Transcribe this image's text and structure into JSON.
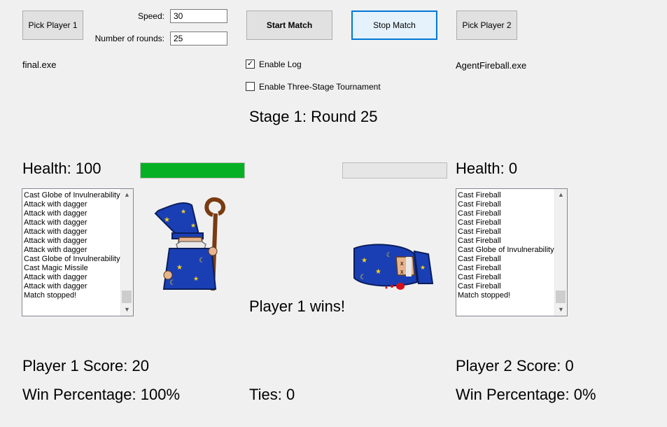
{
  "buttons": {
    "pick_player1": "Pick Player 1",
    "start_match": "Start Match",
    "stop_match": "Stop Match",
    "pick_player2": "Pick Player 2"
  },
  "settings": {
    "speed_label": "Speed:",
    "speed_value": "30",
    "rounds_label": "Number of rounds:",
    "rounds_value": "25",
    "enable_log_label": "Enable Log",
    "enable_log_checked": true,
    "three_stage_label": "Enable Three-Stage Tournament",
    "three_stage_checked": false
  },
  "player1": {
    "file": "final.exe",
    "health_text": "Health: 100",
    "health_fraction": 1.0,
    "score_text": "Player 1 Score: 20",
    "win_pct_text": "Win Percentage: 100%",
    "log": [
      "Cast Globe of Invulnerability",
      "Attack with dagger",
      "Attack with dagger",
      "Attack with dagger",
      "Attack with dagger",
      "Attack with dagger",
      "Attack with dagger",
      "Cast Globe of Invulnerability",
      "Cast Magic Missile",
      "Attack with dagger",
      "Attack with dagger",
      "Match stopped!"
    ]
  },
  "player2": {
    "file": "AgentFireball.exe",
    "health_text": "Health: 0",
    "health_fraction": 0.0,
    "score_text": "Player 2 Score: 0",
    "win_pct_text": "Win Percentage: 0%",
    "log": [
      "Cast Fireball",
      "Cast Fireball",
      "Cast Fireball",
      "Cast Fireball",
      "Cast Fireball",
      "Cast Fireball",
      "Cast Globe of Invulnerability",
      "Cast Fireball",
      "Cast Fireball",
      "Cast Fireball",
      "Cast Fireball",
      "Match stopped!"
    ]
  },
  "stage_text": "Stage 1: Round 25",
  "result_text": "Player 1 wins!",
  "ties_text": "Ties: 0",
  "colors": {
    "health_fill": "#06b025",
    "wizard_robe": "#1a3fb5",
    "star": "#f5d21c",
    "staff": "#7a3b12"
  }
}
